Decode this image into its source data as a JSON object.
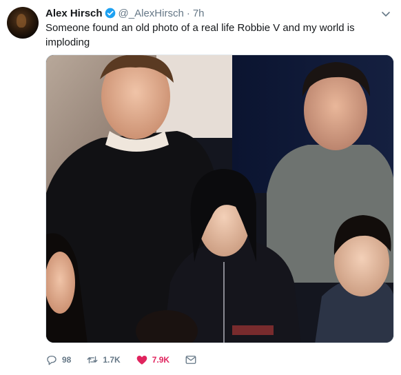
{
  "author": {
    "name": "Alex Hirsch",
    "handle": "@_AlexHirsch",
    "separator": "·",
    "time": "7h"
  },
  "tweet": {
    "text": "Someone found an old photo of a real life Robbie V and my world is imploding"
  },
  "media": {
    "alt": "photo"
  },
  "actions": {
    "replies": "98",
    "retweets": "1.7K",
    "likes": "7.9K"
  },
  "colors": {
    "accent": "#1da1f2",
    "like": "#e0245e",
    "secondary_text": "#657786"
  }
}
